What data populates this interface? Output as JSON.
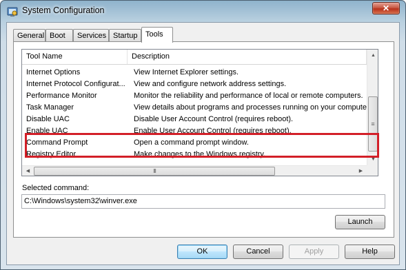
{
  "window": {
    "title": "System Configuration",
    "close_glyph": "✕"
  },
  "tabs": [
    {
      "label": "General"
    },
    {
      "label": "Boot"
    },
    {
      "label": "Services"
    },
    {
      "label": "Startup"
    },
    {
      "label": "Tools",
      "active": true
    }
  ],
  "tools_list": {
    "columns": [
      "Tool Name",
      "Description"
    ],
    "rows": [
      {
        "name": "Internet Options",
        "description": "View Internet Explorer settings."
      },
      {
        "name": "Internet Protocol Configurat...",
        "description": "View and configure network address settings."
      },
      {
        "name": "Performance Monitor",
        "description": "Monitor the reliability and performance of local or remote computers."
      },
      {
        "name": "Task Manager",
        "description": "View details about programs and processes running on your computer."
      },
      {
        "name": "Disable UAC",
        "description": "Disable User Account Control (requires reboot)."
      },
      {
        "name": "Enable UAC",
        "description": "Enable User Account Control (requires reboot)."
      },
      {
        "name": "Command Prompt",
        "description": "Open a command prompt window."
      },
      {
        "name": "Registry Editor",
        "description": "Make changes to the Windows registry."
      }
    ],
    "highlight_color": "#d31f28"
  },
  "selected_command": {
    "label": "Selected command:",
    "value": "C:\\Windows\\system32\\winver.exe"
  },
  "buttons": {
    "launch": "Launch",
    "ok": "OK",
    "cancel": "Cancel",
    "apply": "Apply",
    "help": "Help"
  }
}
